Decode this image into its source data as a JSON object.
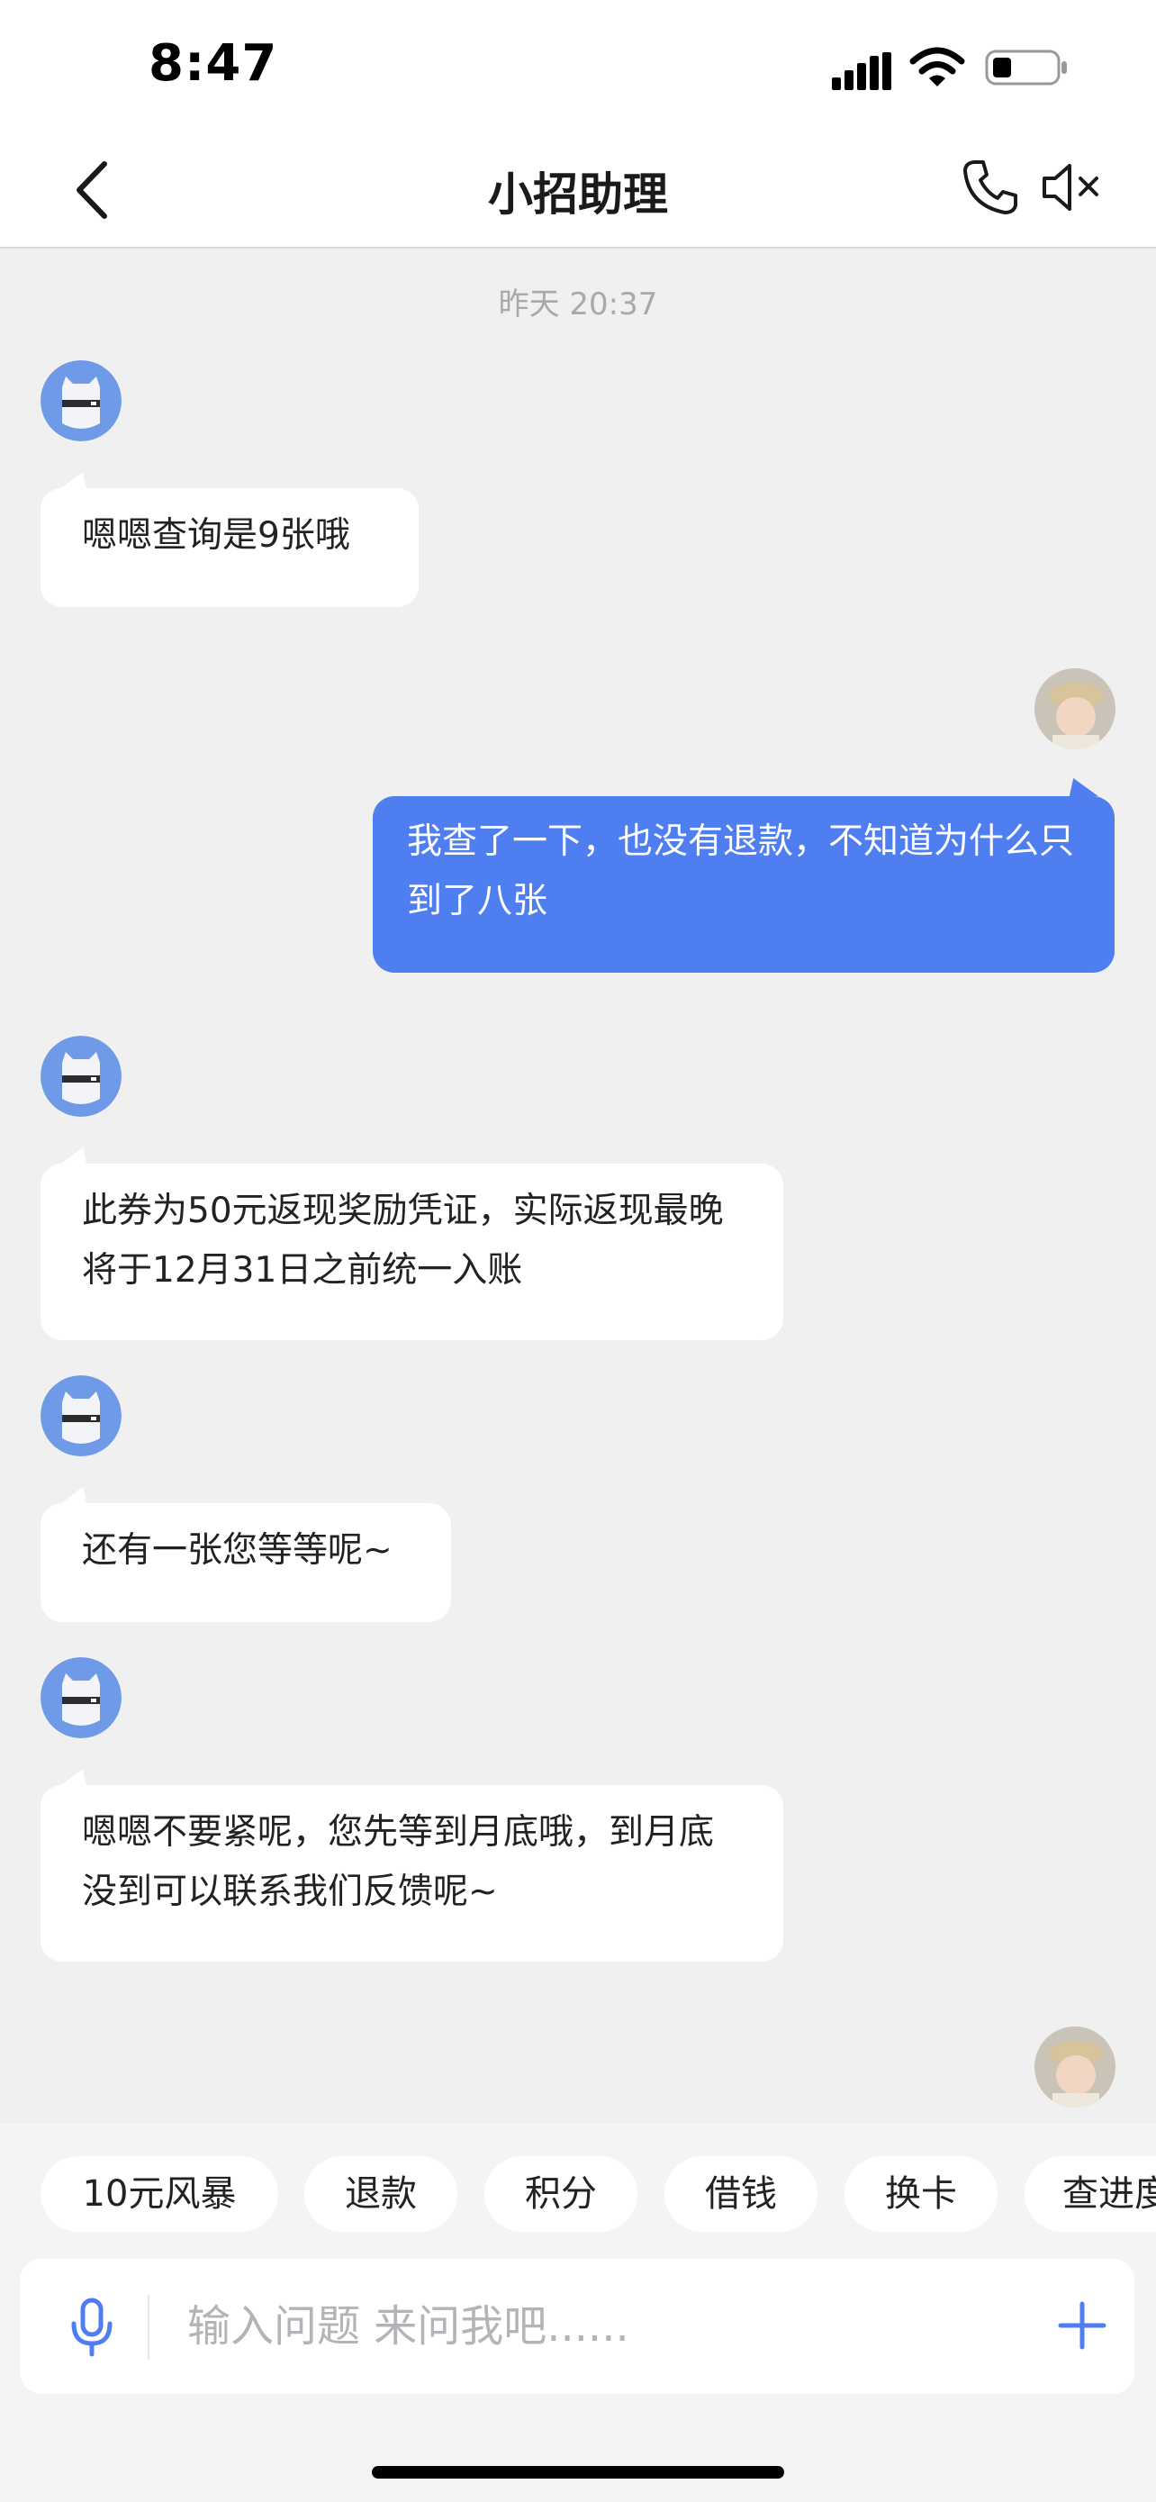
{
  "status_bar": {
    "time": "8:47"
  },
  "nav": {
    "title": "小招助理"
  },
  "chat": {
    "timestamp": "昨天 20:37",
    "messages": [
      {
        "side": "in",
        "text": "嗯嗯查询是9张哦"
      },
      {
        "side": "out",
        "text": "我查了一下，也没有退款，不知道为什么只到了八张"
      },
      {
        "side": "in",
        "text": "此券为50元返现奖励凭证，实际返现最晚将于12月31日之前统一入账"
      },
      {
        "side": "in",
        "text": "还有一张您等等呢~"
      },
      {
        "side": "in",
        "text": "嗯嗯不要紧呢，您先等到月底哦，到月底没到可以联系我们反馈呢~"
      }
    ]
  },
  "quick_replies": [
    "10元风暴",
    "退款",
    "积分",
    "借钱",
    "换卡",
    "查进度"
  ],
  "input": {
    "placeholder": "输入问题 来问我吧......"
  },
  "colors": {
    "accent": "#4f7ef1",
    "background": "#f0f0f1"
  }
}
